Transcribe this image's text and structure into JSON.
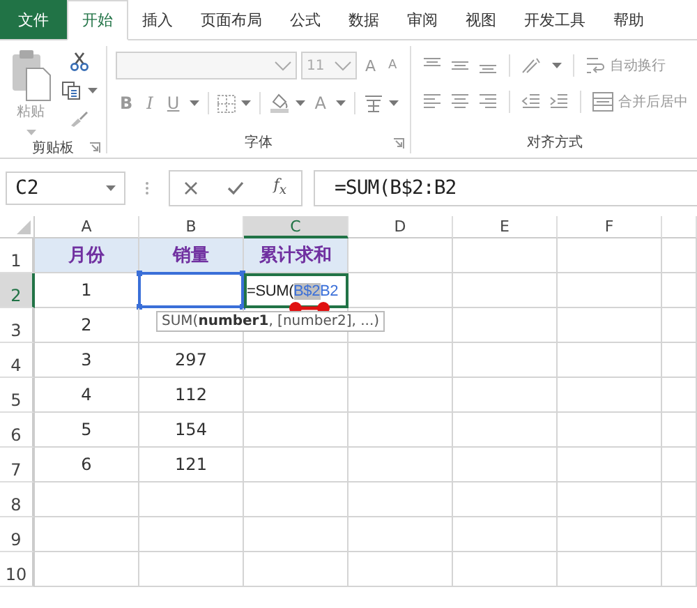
{
  "tabs": [
    {
      "label": "文件",
      "kind": "file",
      "selected": false
    },
    {
      "label": "开始",
      "kind": "tab",
      "selected": true
    },
    {
      "label": "插入",
      "kind": "tab",
      "selected": false
    },
    {
      "label": "页面布局",
      "kind": "tab",
      "selected": false
    },
    {
      "label": "公式",
      "kind": "tab",
      "selected": false
    },
    {
      "label": "数据",
      "kind": "tab",
      "selected": false
    },
    {
      "label": "审阅",
      "kind": "tab",
      "selected": false
    },
    {
      "label": "视图",
      "kind": "tab",
      "selected": false
    },
    {
      "label": "开发工具",
      "kind": "tab",
      "selected": false
    },
    {
      "label": "帮助",
      "kind": "tab",
      "selected": false
    }
  ],
  "ribbon": {
    "clipboard": {
      "paste_label": "粘贴",
      "group_label": "剪贴板"
    },
    "font": {
      "font_size": "11",
      "grow_label": "A",
      "shrink_label": "A",
      "bold_label": "B",
      "italic_label": "I",
      "underline_label": "U",
      "font_color_label": "A",
      "group_label": "字体"
    },
    "alignment": {
      "wrap_label": "自动换行",
      "merge_label": "合并后居中",
      "group_label": "对齐方式"
    }
  },
  "formula_bar": {
    "name_box": "C2",
    "fx_label": "f$_{x}$",
    "formula": "=SUM(B$2:B2"
  },
  "columns": [
    {
      "label": "A",
      "selected": false
    },
    {
      "label": "B",
      "selected": false
    },
    {
      "label": "C",
      "selected": true
    },
    {
      "label": "D",
      "selected": false
    },
    {
      "label": "E",
      "selected": false
    },
    {
      "label": "F",
      "selected": false
    }
  ],
  "rows": [
    {
      "header": "1",
      "selected": false,
      "cells": [
        {
          "kind": "heading",
          "text": "月份"
        },
        {
          "kind": "heading",
          "text": "销量"
        },
        {
          "kind": "heading",
          "text": "累计求和"
        }
      ]
    },
    {
      "header": "2",
      "selected": true,
      "cells": [
        {
          "kind": "value",
          "text": "1"
        },
        {
          "kind": "ref-range"
        },
        {
          "kind": "editing",
          "parts": [
            {
              "kind": "plain",
              "text": "=SUM("
            },
            {
              "kind": "ref-selected",
              "text": "B$2"
            },
            {
              "kind": "ref",
              "text": "B2"
            }
          ]
        }
      ]
    },
    {
      "header": "3",
      "selected": false,
      "cells": [
        {
          "kind": "value",
          "text": "2"
        }
      ]
    },
    {
      "header": "4",
      "selected": false,
      "cells": [
        {
          "kind": "value",
          "text": "3"
        },
        {
          "kind": "value",
          "text": "297"
        }
      ]
    },
    {
      "header": "5",
      "selected": false,
      "cells": [
        {
          "kind": "value",
          "text": "4"
        },
        {
          "kind": "value",
          "text": "112"
        }
      ]
    },
    {
      "header": "6",
      "selected": false,
      "cells": [
        {
          "kind": "value",
          "text": "5"
        },
        {
          "kind": "value",
          "text": "154"
        }
      ]
    },
    {
      "header": "7",
      "selected": false,
      "cells": [
        {
          "kind": "value",
          "text": "6"
        },
        {
          "kind": "value",
          "text": "121"
        }
      ]
    },
    {
      "header": "8",
      "selected": false,
      "cells": []
    },
    {
      "header": "9",
      "selected": false,
      "cells": []
    },
    {
      "header": "10",
      "selected": false,
      "cells": []
    }
  ],
  "tooltip": "SUM(**number1**, [number2], ...)"
}
